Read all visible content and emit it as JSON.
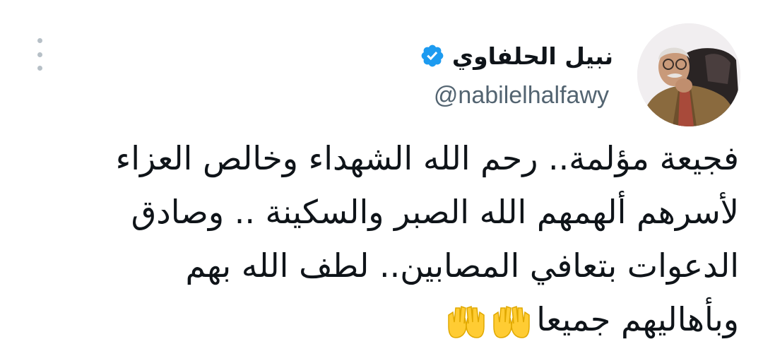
{
  "tweet": {
    "display_name": "نبيل الحلفاوي",
    "handle": "@nabilelhalfawy",
    "text_lines": [
      "فجيعة مؤلمة.. رحم الله الشهداء وخالص العزاء",
      "لأسرهم ألهمهم الله الصبر والسكينة .. وصادق",
      "الدعوات بتعافي المصابين.. لطف الله بهم",
      "وبأهاليهم جميعا"
    ],
    "emoji_icons": [
      "raising-hands-icon",
      "raising-hands-icon"
    ],
    "verified_icon": "verified-badge-icon",
    "menu_icon": "more-vertical-icon"
  },
  "colors": {
    "text_primary": "#0f1419",
    "text_secondary": "#536471",
    "verified_blue": "#1d9bf0",
    "menu_dots": "#b7c0c7",
    "emoji_yellow": "#ffcc33"
  }
}
